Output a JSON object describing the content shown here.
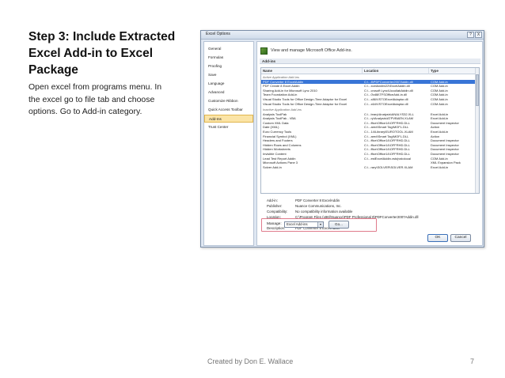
{
  "slide": {
    "title_lines": [
      "Step 3: Include Extracted",
      "Excel Add-in to Excel",
      "Package"
    ],
    "body_lines": [
      "Open excel from programs menu. In",
      "the excel go to file tab and choose",
      "options. Go to Add-in category."
    ],
    "footer": "Created by Don E. Wallace",
    "page_number": "7"
  },
  "dialog": {
    "title": "Excel Options",
    "help_button": "?",
    "close_button": "X",
    "nav": [
      {
        "label": "General"
      },
      {
        "label": "Formulas"
      },
      {
        "label": "Proofing"
      },
      {
        "label": "Save"
      },
      {
        "label": "Language"
      },
      {
        "label": "Advanced"
      },
      {
        "label": "Customize Ribbon"
      },
      {
        "label": "Quick Access Toolbar"
      },
      {
        "label": "Add-Ins"
      },
      {
        "label": "Trust Center"
      }
    ],
    "header_text": "View and manage Microsoft Office Add-ins.",
    "section_title": "Add-ins",
    "columns": [
      "Name",
      "Location",
      "Type"
    ],
    "group_active": "Active Application Add-ins",
    "active_rows": [
      {
        "name": "PDF Converter 8 ExcelAddin",
        "location": "C:\\...8\\PDFConverter2007Addin.dll",
        "type": "COM Add-in"
      },
      {
        "name": "PDF Create 8 Excel Addin",
        "location": "C:\\...xcelAddin\\22\\ExcelAddin.dll",
        "type": "COM Add-in"
      },
      {
        "name": "Sharing Add-in for Microsoft Lync 2010",
        "location": "C:\\...crosoft Lync\\UccollabAddin.dll",
        "type": "COM Add-in"
      },
      {
        "name": "Team Foundation Add-in",
        "location": "C:\\...0\\x86\\TFSOfficeAdd-in.dll",
        "type": "COM Add-in"
      },
      {
        "name": "Visual Studio Tools for Office Design-Time Adaptor for Excel",
        "location": "C:\\...x86\\VSTOExcelAdaptor.dll",
        "type": "COM Add-in"
      },
      {
        "name": "Visual Studio Tools for Office Design-Time Adaptor for Excel",
        "location": "C:\\...x64\\VSTOExcelAdaptor.dll",
        "type": "COM Add-in"
      }
    ],
    "group_inactive": "Inactive Application Add-ins",
    "inactive_rows": [
      {
        "name": "Analysis ToolPak",
        "location": "C:\\...brary\\Analysis\\ANALYS32.XLL",
        "type": "Excel Add-in"
      },
      {
        "name": "Analysis ToolPak - VBA",
        "location": "C:\\...ry\\Analysis\\ATPVBAEN.XLAM",
        "type": "Excel Add-in"
      },
      {
        "name": "Custom XML Data",
        "location": "C:\\...ffice\\Office14\\OFFRHD.DLL",
        "type": "Document Inspector"
      },
      {
        "name": "Date (XML)",
        "location": "C:\\...ared\\Smart Tag\\MOFL.DLL",
        "type": "Action"
      },
      {
        "name": "Euro Currency Tools",
        "location": "C:\\...14\\Library\\EUROTOOL.XLAM",
        "type": "Excel Add-in"
      },
      {
        "name": "Financial Symbol (XML)",
        "location": "C:\\...ared\\Smart Tag\\MOFL.DLL",
        "type": "Action"
      },
      {
        "name": "Headers and Footers",
        "location": "C:\\...ffice\\Office14\\OFFRHD.DLL",
        "type": "Document Inspector"
      },
      {
        "name": "Hidden Rows and Columns",
        "location": "C:\\...ffice\\Office14\\OFFRHD.DLL",
        "type": "Document Inspector"
      },
      {
        "name": "Hidden Worksheets",
        "location": "C:\\...ffice\\Office14\\OFFRHD.DLL",
        "type": "Document Inspector"
      },
      {
        "name": "Invisible Content",
        "location": "C:\\...ffice\\Office14\\OFFRHD.DLL",
        "type": "Document Inspector"
      },
      {
        "name": "Lead Test Report Addin",
        "location": "C:\\...estExcelAddin.vsto|vstolocal",
        "type": "COM Add-in"
      },
      {
        "name": "Microsoft Actions Pane 3",
        "location": "",
        "type": "XML Expansion Pack"
      },
      {
        "name": "Solver Add-in",
        "location": "C:\\...rary\\SOLVER\\SOLVER.XLAM",
        "type": "Excel Add-in"
      }
    ],
    "details": [
      {
        "key": "Add-in:",
        "value": "PDF Converter 8 ExcelAddin"
      },
      {
        "key": "Publisher:",
        "value": "Nuance Communications, Inc."
      },
      {
        "key": "Compatibility:",
        "value": "No compatibility information available"
      },
      {
        "key": "Location:",
        "value": "C:\\Program Files (x86)\\Nuance\\PDF Professional 8\\PDFConverter2007Addin.dll"
      },
      {
        "key": "",
        "value": ""
      },
      {
        "key": "Description:",
        "value": "PDF Converter 8 ExcelAddin"
      }
    ],
    "manage_label": "Manage:",
    "manage_value": "Excel Add-ins",
    "go_button": "Go...",
    "ok_button": "OK",
    "cancel_button": "Cancel"
  }
}
